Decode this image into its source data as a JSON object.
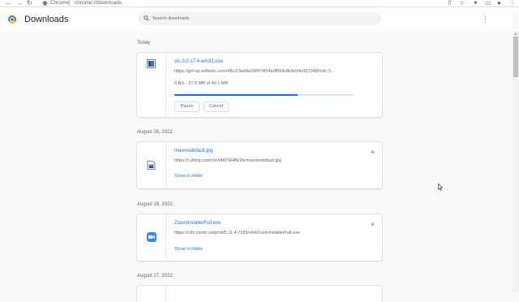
{
  "browser": {
    "url_scheme": "Chrome",
    "url_path": "chrome://downloads"
  },
  "header": {
    "title": "Downloads",
    "search_placeholder": "Search downloads"
  },
  "sections": [
    {
      "date": "Today",
      "item": {
        "name": "vlc-3.0.17.4-win32.exe",
        "url": "https://gsf-sp.softonic.com/48c/23a/bfa29f974f04e0ff50b3b3e04e9570480/vlc-3...",
        "progress_text": "0 B/s - 27.5 MB of 40.1 MB",
        "progress_fraction": 0.686,
        "pause_label": "Pause",
        "cancel_label": "Cancel"
      }
    },
    {
      "date": "August 26, 2022",
      "item": {
        "name": "maxresdefault.jpg",
        "url": "https://i.ytimg.com/vi/sWAYW4Br1Ik/maxresdefault.jpg",
        "action_label": "Show in folder"
      }
    },
    {
      "date": "August 19, 2022",
      "item": {
        "name": "ZoomInstallerFull.exe",
        "url": "https://cdn.zoom.us/prod/5.11.4.7185/x64/ZoomInstallerFull.exe",
        "action_label": "Show in folder"
      }
    },
    {
      "date": "August 17, 2022"
    }
  ],
  "colors": {
    "accent": "#1a73e8",
    "progress_track": "#d2e3fc",
    "zoom_blue": "#2d8cff",
    "vlc_blue": "#3d6fd6"
  }
}
